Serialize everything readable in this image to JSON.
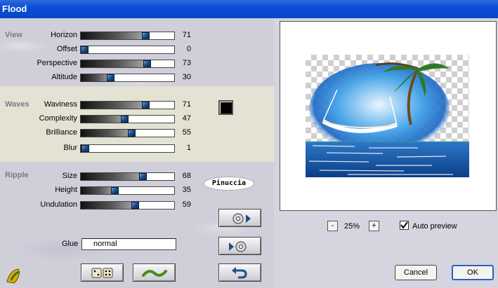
{
  "window": {
    "title": "Flood"
  },
  "sections": {
    "view": "View",
    "waves": "Waves",
    "ripple": "Ripple"
  },
  "sliders": {
    "horizon": {
      "label": "Horizon",
      "value": 71
    },
    "offset": {
      "label": "Offset",
      "value": 0
    },
    "perspective": {
      "label": "Perspective",
      "value": 73
    },
    "altitude": {
      "label": "Altitude",
      "value": 30
    },
    "waviness": {
      "label": "Waviness",
      "value": 71
    },
    "complexity": {
      "label": "Complexity",
      "value": 47
    },
    "brilliance": {
      "label": "Brilliance",
      "value": 55
    },
    "blur": {
      "label": "Blur",
      "value": 1
    },
    "size": {
      "label": "Size",
      "value": 68
    },
    "height": {
      "label": "Height",
      "value": 35
    },
    "undulation": {
      "label": "Undulation",
      "value": 59
    }
  },
  "color_swatch": {
    "color": "#000000"
  },
  "logo": {
    "text": "Pinuccia"
  },
  "glue": {
    "label": "Glue",
    "value": "normal"
  },
  "preview": {
    "zoom_minus": "-",
    "zoom_value": "25%",
    "zoom_plus": "+",
    "auto_preview_label": "Auto preview",
    "auto_preview_checked": true
  },
  "buttons": {
    "cancel": "Cancel",
    "ok": "OK"
  },
  "icons": {
    "app": "plugin-logo-icon",
    "next_preset": "disc-forward-icon",
    "prev_preset": "disc-back-icon",
    "random": "dice-icon",
    "wave": "wave-icon",
    "reset": "undo-arrow-icon"
  },
  "colors": {
    "titlebar": "#0a4fd8",
    "band": "#e3e2d3",
    "background": "#cfced9"
  }
}
